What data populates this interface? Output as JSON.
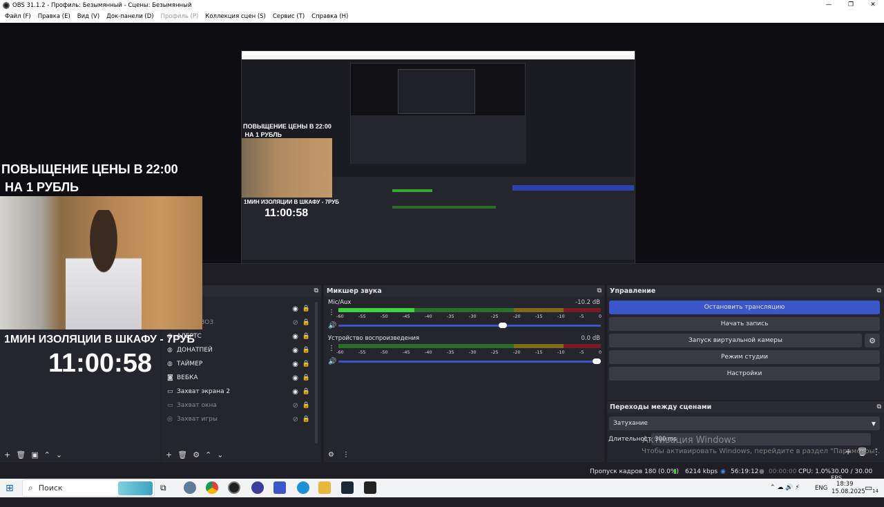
{
  "window": {
    "title": "OBS 31.1.2 - Профиль: Безымянный - Сцены: Безымянный",
    "controls": [
      "—",
      "❐",
      "✕"
    ]
  },
  "menu": [
    {
      "label": "Файл (F)",
      "disabled": false
    },
    {
      "label": "Правка (E)",
      "disabled": false
    },
    {
      "label": "Вид (V)",
      "disabled": false
    },
    {
      "label": "Док-панели (D)",
      "disabled": false
    },
    {
      "label": "Профиль (P)",
      "disabled": true
    },
    {
      "label": "Коллекция сцен (S)",
      "disabled": false
    },
    {
      "label": "Сервис (T)",
      "disabled": false
    },
    {
      "label": "Справка (H)",
      "disabled": false
    }
  ],
  "preview": {
    "overlay_title": "ПОВЫЩЕНИЕ ЦЕНЫ В 22:00\n НА 1 РУБЛЬ",
    "overlay_caption": "1МИН ИЗОЛЯЦИИ В ШКАФУ - 7РУБ",
    "overlay_clock": "11:00:58",
    "nested_title": "ПОВЫЩЕНИЕ ЦЕНЫ В 22:00\n НА 1 РУБЛЬ",
    "nested_caption": "1МИН ИЗОЛЯЦИИ В ШКАФУ - 7РУБ",
    "nested_clock": "11:00:58"
  },
  "sources": {
    "items": [
      {
        "icon": "⬚",
        "label": "(+)",
        "visible": true,
        "dim": false
      },
      {
        "icon": "ab",
        "label": "ТОП ЗАВОЗ",
        "visible": false,
        "dim": true
      },
      {
        "icon": "◍",
        "label": "АЛЕРТС",
        "visible": true,
        "dim": false
      },
      {
        "icon": "◍",
        "label": "ДОНАТПЕЙ",
        "visible": true,
        "dim": false
      },
      {
        "icon": "◍",
        "label": "ТАЙМЕР",
        "visible": true,
        "dim": false
      },
      {
        "icon": "◙",
        "label": "ВЕБКА",
        "visible": true,
        "dim": false
      },
      {
        "icon": "▭",
        "label": "Захват экрана 2",
        "visible": true,
        "dim": false
      },
      {
        "icon": "▭",
        "label": "Захват окна",
        "visible": false,
        "dim": true
      },
      {
        "icon": "◎",
        "label": "Захват игры",
        "visible": false,
        "dim": true
      }
    ]
  },
  "mixer": {
    "title": "Микшер звука",
    "ticks": [
      "-60",
      "-55",
      "-50",
      "-45",
      "-40",
      "-35",
      "-30",
      "-25",
      "-20",
      "-15",
      "-10",
      "-5",
      "0"
    ],
    "channels": [
      {
        "name": "Mic/Aux",
        "db": "-10.2 dB",
        "level": 0.29,
        "volume": 0.63
      },
      {
        "name": "Устройство воспроизведения",
        "db": "0.0 dB",
        "level": 0.0,
        "volume": 1.0
      }
    ]
  },
  "controls": {
    "title": "Управление",
    "stop_stream": "Остановить трансляцию",
    "start_record": "Начать запись",
    "virtual_cam": "Запуск виртуальной камеры",
    "studio_mode": "Режим студии",
    "settings": "Настройки"
  },
  "transitions": {
    "title": "Переходы между сценами",
    "selected": "Затухание",
    "duration_label": "Длительность",
    "duration_value": "300 ms"
  },
  "watermark": {
    "line1": "Активация Windows",
    "line2": "Чтобы активировать Windows, перейдите в раздел \"Параметры\"."
  },
  "status": {
    "dropped": "Пропуск кадров 180 (0.0%)",
    "bitrate": "6214 kbps",
    "stream_time": "56:19:12",
    "rec_time": "00:00:00",
    "cpu": "CPU: 1.0%",
    "fps": "30.00 / 30.00 FPS"
  },
  "taskbar": {
    "search": "Поиск",
    "lang": "ENG",
    "time": "18:39",
    "date": "15.08.2025",
    "notif_count": "14"
  },
  "colors": {
    "accent": "#3a56c8",
    "panel": "#25252d",
    "meter_green": "#3fd23f"
  }
}
